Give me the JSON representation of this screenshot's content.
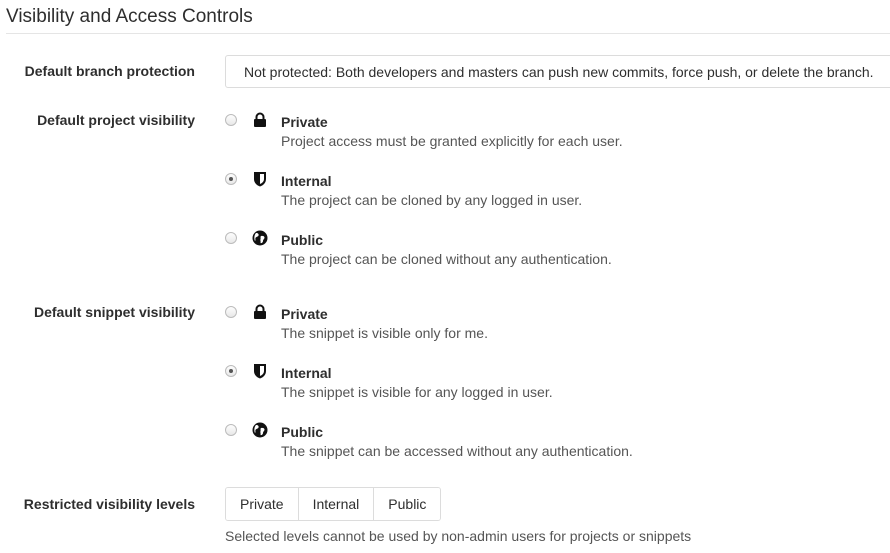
{
  "section": {
    "title": "Visibility and Access Controls"
  },
  "branch_protection": {
    "label": "Default branch protection",
    "selected": "Not protected: Both developers and masters can push new commits, force push, or delete the branch."
  },
  "project_visibility": {
    "label": "Default project visibility",
    "options": [
      {
        "title": "Private",
        "description": "Project access must be granted explicitly for each user.",
        "icon": "lock-icon",
        "checked": false
      },
      {
        "title": "Internal",
        "description": "The project can be cloned by any logged in user.",
        "icon": "shield-icon",
        "checked": true
      },
      {
        "title": "Public",
        "description": "The project can be cloned without any authentication.",
        "icon": "globe-icon",
        "checked": false
      }
    ]
  },
  "snippet_visibility": {
    "label": "Default snippet visibility",
    "options": [
      {
        "title": "Private",
        "description": "The snippet is visible only for me.",
        "icon": "lock-icon",
        "checked": false
      },
      {
        "title": "Internal",
        "description": "The snippet is visible for any logged in user.",
        "icon": "shield-icon",
        "checked": true
      },
      {
        "title": "Public",
        "description": "The snippet can be accessed without any authentication.",
        "icon": "globe-icon",
        "checked": false
      }
    ]
  },
  "restricted_levels": {
    "label": "Restricted visibility levels",
    "buttons": [
      "Private",
      "Internal",
      "Public"
    ],
    "help": "Selected levels cannot be used by non-admin users for projects or snippets"
  }
}
